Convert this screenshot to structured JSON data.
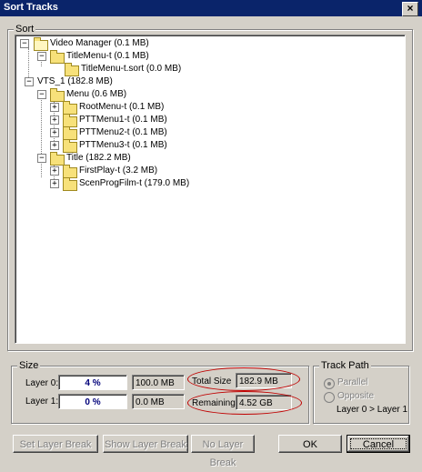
{
  "window": {
    "title": "Sort Tracks",
    "close": "×"
  },
  "sort": {
    "legend": "Sort",
    "tree": [
      {
        "label": "Video Manager (0.1 MB)",
        "toggle": "−"
      },
      {
        "label": "TitleMenu-t (0.1 MB)",
        "toggle": "−"
      },
      {
        "label": "TitleMenu-t.sort (0.0 MB)",
        "toggle": ""
      },
      {
        "label": "VTS_1 (182.8 MB)",
        "toggle": "−"
      },
      {
        "label": "Menu (0.6 MB)",
        "toggle": "−"
      },
      {
        "label": "RootMenu-t (0.1 MB)",
        "toggle": "+"
      },
      {
        "label": "PTTMenu1-t (0.1 MB)",
        "toggle": "+"
      },
      {
        "label": "PTTMenu2-t (0.1 MB)",
        "toggle": "+"
      },
      {
        "label": "PTTMenu3-t (0.1 MB)",
        "toggle": "+"
      },
      {
        "label": "Title (182.2 MB)",
        "toggle": "−"
      },
      {
        "label": "FirstPlay-t (3.2 MB)",
        "toggle": "+"
      },
      {
        "label": "ScenProgFilm-t (179.0 MB)",
        "toggle": "+"
      }
    ]
  },
  "size": {
    "legend": "Size",
    "layer0_label": "Layer 0:",
    "layer0_percent": "4 %",
    "layer0_percent_value": 4,
    "layer0_size": "100.0 MB",
    "layer1_label": "Layer 1:",
    "layer1_percent": "0 %",
    "layer1_percent_value": 0,
    "layer1_size": "0.0 MB",
    "total_label": "Total Size",
    "total_value": "182.9 MB",
    "remaining_label": "Remaining:",
    "remaining_value": "4.52 GB"
  },
  "track_path": {
    "legend": "Track Path",
    "parallel": "Parallel",
    "opposite": "Opposite",
    "note": "Layer 0 > Layer 1"
  },
  "buttons": {
    "set_layer_break": "Set Layer Break",
    "show_layer_break": "Show Layer Break",
    "no_layer_break": "No Layer Break",
    "ok": "OK",
    "cancel": "Cancel"
  },
  "colors": {
    "titlebar": "#0a246a",
    "annotation": "#c00000",
    "face": "#d4d0c8"
  }
}
